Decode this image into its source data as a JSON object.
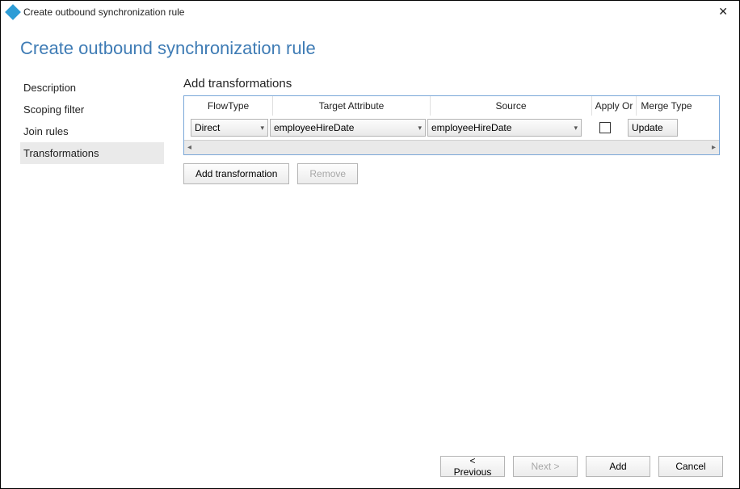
{
  "window": {
    "title": "Create outbound synchronization rule"
  },
  "page": {
    "heading": "Create outbound synchronization rule"
  },
  "sidebar": {
    "items": [
      {
        "label": "Description"
      },
      {
        "label": "Scoping filter"
      },
      {
        "label": "Join rules"
      },
      {
        "label": "Transformations",
        "active": true
      }
    ]
  },
  "main": {
    "section_title": "Add transformations",
    "columns": {
      "flowtype": "FlowType",
      "target": "Target Attribute",
      "source": "Source",
      "apply": "Apply Or",
      "merge": "Merge Type"
    },
    "row": {
      "flowtype": "Direct",
      "target": "employeeHireDate",
      "source": "employeeHireDate",
      "apply_once_checked": false,
      "merge": "Update"
    },
    "buttons": {
      "add_transformation": "Add transformation",
      "remove": "Remove"
    }
  },
  "footer": {
    "previous": "< Previous",
    "next": "Next >",
    "add": "Add",
    "cancel": "Cancel"
  }
}
